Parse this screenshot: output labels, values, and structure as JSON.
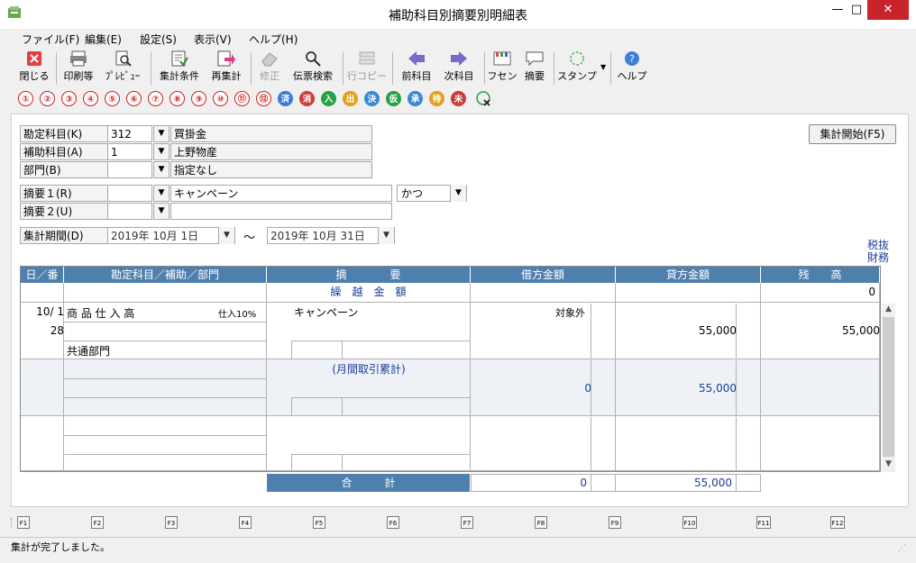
{
  "window": {
    "title": "補助科目別摘要別明細表",
    "minimize": "—",
    "maximize": "□",
    "close": "✕"
  },
  "menu": [
    "ファイル(F)",
    "編集(E)",
    "設定(S)",
    "表示(V)",
    "ヘルプ(H)"
  ],
  "toolbar": {
    "close": "閉じる",
    "print": "印刷等",
    "preview": "ﾌﾟﾚﾋﾞｭｰ",
    "conditions": "集計条件",
    "recalc": "再集計",
    "edit": "修正",
    "slip_search": "伝票検索",
    "row_copy": "行コピー",
    "prev": "前科目",
    "next": "次科目",
    "fusen": "フセン",
    "summary": "摘要",
    "stamp": "スタンプ",
    "help": "ヘルプ"
  },
  "circles": [
    "①",
    "②",
    "③",
    "④",
    "⑤",
    "⑥",
    "⑦",
    "⑧",
    "⑨",
    "⑩",
    "⑪",
    "⑫",
    "済",
    "消",
    "入",
    "出",
    "決",
    "仮",
    "承",
    "待",
    "未"
  ],
  "form": {
    "account_label": "勘定科目(K)",
    "account_code": "312",
    "account_name": "買掛金",
    "sub_label": "補助科目(A)",
    "sub_code": "1",
    "sub_name": "上野物産",
    "dept_label": "部門(B)",
    "dept_code": "",
    "dept_name": "指定なし",
    "tekiyo1_label": "摘要１(R)",
    "tekiyo1_code": "",
    "tekiyo1_text": "キャンペーン",
    "tekiyo2_label": "摘要２(U)",
    "tekiyo2_code": "",
    "tekiyo2_text": "",
    "match_mode": "かつ",
    "period_label": "集計期間(D)",
    "period_from": "2019年 10月  1日",
    "tilde": "〜",
    "period_to": "2019年 10月 31日",
    "start_button": "集計開始(F5)",
    "tax_note": "税抜",
    "acct_note": "財務"
  },
  "grid": {
    "headers": [
      "日／番",
      "勘定科目／補助／部門",
      "摘　　　　要",
      "借方金額",
      "貸方金額",
      "残　　高"
    ],
    "carry": {
      "label": "繰　越　金　額",
      "balance": "0"
    },
    "row1": {
      "date": "10/ 1",
      "no": "28",
      "account": "商 品 仕 入 高",
      "tax": "仕入10%",
      "dept": "共通部門",
      "tekiyo": "キャンペーン",
      "debit_note": "対象外",
      "credit": "55,000",
      "balance": "55,000"
    },
    "monthly": {
      "label": "(月間取引累計)",
      "debit": "0",
      "credit": "55,000"
    },
    "total": {
      "label": "合　　　計",
      "debit": "0",
      "credit": "55,000"
    }
  },
  "fkeys": [
    "F1",
    "F2",
    "F3",
    "F4",
    "F5",
    "F6",
    "F7",
    "F8",
    "F9",
    "F10",
    "F11",
    "F12"
  ],
  "status": "集計が完了しました。"
}
